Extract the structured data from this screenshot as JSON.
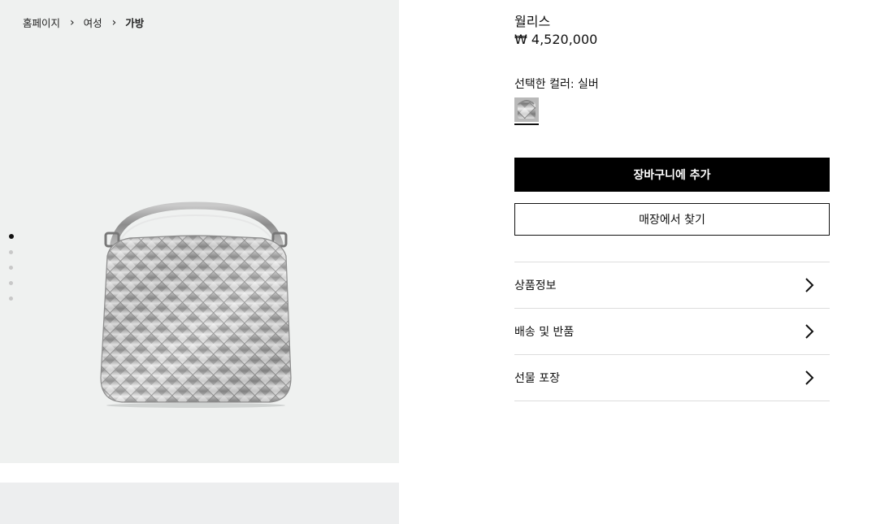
{
  "breadcrumb": {
    "items": [
      "홈페이지",
      "여성",
      "가방"
    ]
  },
  "gallery": {
    "image_icon": "silver-woven-handbag-image",
    "dots": [
      true,
      false,
      false,
      false,
      false
    ]
  },
  "product": {
    "title": "월리스",
    "price": "₩ 4,520,000",
    "color_label": "선택한 컬러: 실버"
  },
  "actions": {
    "add_to_cart": "장바구니에 추가",
    "find_in_store": "매장에서 찾기"
  },
  "accordion": {
    "items": [
      "상품정보",
      "배송 및 반품",
      "선물 포장"
    ]
  },
  "colors": {
    "gallery_bg": "#eff1f0",
    "primary_button": "#000000",
    "divider": "#dddddd"
  }
}
